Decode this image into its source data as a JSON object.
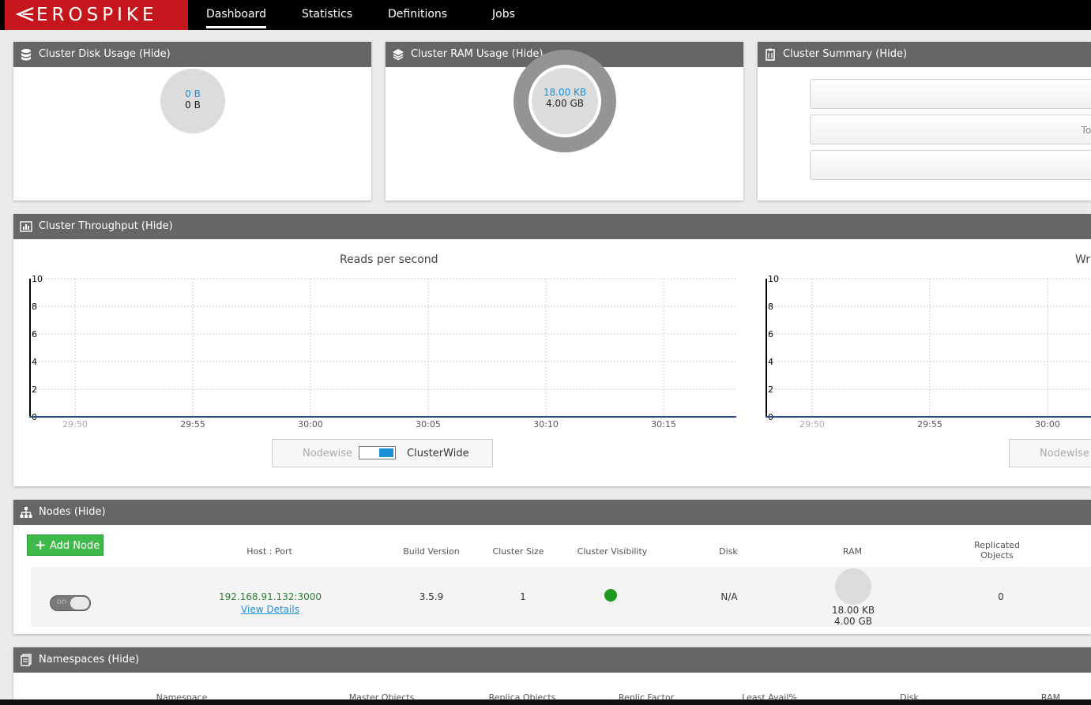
{
  "brand": {
    "name": "EROSPIKE",
    "color": "#c4161c"
  },
  "nav": {
    "items": [
      {
        "label": "Dashboard",
        "active": true
      },
      {
        "label": "Statistics",
        "active": false
      },
      {
        "label": "Definitions",
        "active": false
      },
      {
        "label": "Jobs",
        "active": false
      }
    ]
  },
  "disk_panel": {
    "title": "Cluster Disk Usage (Hide)",
    "used": "0 B",
    "total": "0 B"
  },
  "ram_panel": {
    "title": "Cluster RAM Usage (Hide)",
    "used": "18.00 KB",
    "total": "4.00 GB"
  },
  "summary_panel": {
    "title": "Cluster Summary (Hide)",
    "rows": [
      "",
      "Tot",
      ""
    ]
  },
  "throughput_panel": {
    "title": "Cluster Throughput (Hide)",
    "charts": [
      {
        "title": "Reads per second",
        "y_ticks": [
          "10",
          "8",
          "6",
          "4",
          "2",
          "0"
        ],
        "x_ticks": [
          "29:50",
          "29:55",
          "30:00",
          "30:05",
          "30:10",
          "30:15"
        ],
        "toggle": {
          "left": "Nodewise",
          "right": "ClusterWide"
        }
      },
      {
        "title": "Wr",
        "y_ticks": [
          "10",
          "8",
          "6",
          "4",
          "2",
          "0"
        ],
        "x_ticks": [
          "29:50",
          "29:55",
          "30:00"
        ],
        "toggle": {
          "left": "Nodewise"
        }
      }
    ]
  },
  "chart_data": [
    {
      "type": "line",
      "title": "Reads per second",
      "x": [
        "29:50",
        "29:55",
        "30:00",
        "30:05",
        "30:10",
        "30:15"
      ],
      "series": [
        {
          "values": [
            0,
            0,
            0,
            0,
            0,
            0
          ]
        }
      ],
      "ylim": [
        0,
        10
      ],
      "grid": true
    },
    {
      "type": "line",
      "title": "Wr",
      "x": [
        "29:50",
        "29:55",
        "30:00"
      ],
      "series": [
        {
          "values": [
            0,
            0,
            0
          ]
        }
      ],
      "ylim": [
        0,
        10
      ],
      "grid": true
    }
  ],
  "nodes_panel": {
    "title": "Nodes (Hide)",
    "add_label": "Add Node",
    "columns": [
      "Host : Port",
      "Build Version",
      "Cluster Size",
      "Cluster Visibility",
      "Disk",
      "RAM",
      "Replicated",
      "Objects"
    ],
    "rows": [
      {
        "switch": "on",
        "host": "192.168.91.132:3000",
        "details": "View Details",
        "build": "3.5.9",
        "cluster_size": "1",
        "disk": "N/A",
        "ram_used": "18.00 KB",
        "ram_total": "4.00 GB",
        "replicated": "0"
      }
    ]
  },
  "namespaces_panel": {
    "title": "Namespaces (Hide)",
    "columns": [
      "Namespace",
      "Master Objects",
      "Replica Objects",
      "Replic Factor",
      "Least Avail%",
      "Disk",
      "RAM"
    ]
  }
}
